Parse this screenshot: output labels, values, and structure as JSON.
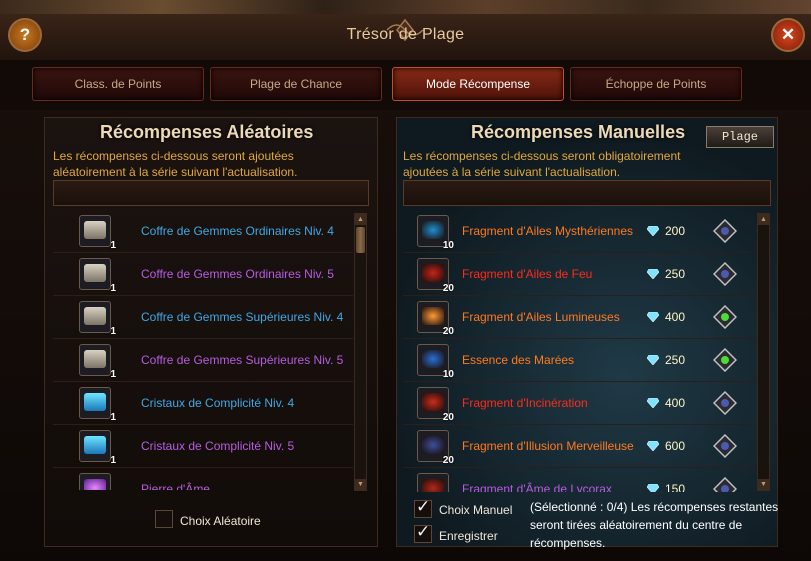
{
  "window": {
    "title": "Trésor de Plage",
    "help_label": "?",
    "close_label": "✕"
  },
  "tabs": [
    {
      "label": "Class. de Points",
      "active": false
    },
    {
      "label": "Plage de Chance",
      "active": false
    },
    {
      "label": "Mode Récompense",
      "active": true
    },
    {
      "label": "Échoppe de Points",
      "active": false
    }
  ],
  "random_panel": {
    "title": "Récompenses Aléatoires",
    "description_line1": "Les récompenses ci-dessous seront ajoutées",
    "description_line2": "aléatoirement à la série suivant l'actualisation.",
    "items": [
      {
        "name": "Coffre de Gemmes Ordinaires Niv. 4",
        "qty": "1",
        "color": "#3fa8e6",
        "icon": "chest-icon"
      },
      {
        "name": "Coffre de Gemmes Ordinaires Niv. 5",
        "qty": "1",
        "color": "#b75ce0",
        "icon": "chest-icon"
      },
      {
        "name": "Coffre de Gemmes Supérieures Niv. 4",
        "qty": "1",
        "color": "#3fa8e6",
        "icon": "chest-icon"
      },
      {
        "name": "Coffre de Gemmes Supérieures Niv. 5",
        "qty": "1",
        "color": "#b75ce0",
        "icon": "chest-icon"
      },
      {
        "name": "Cristaux de Complicité Niv. 4",
        "qty": "1",
        "color": "#3fa8e6",
        "icon": "crystal-icon"
      },
      {
        "name": "Cristaux de Complicité Niv. 5",
        "qty": "1",
        "color": "#b75ce0",
        "icon": "crystal-icon"
      },
      {
        "name": "Pierre d'Âme",
        "qty": "",
        "color": "#b75ce0",
        "icon": "soul-stone-icon"
      }
    ],
    "random_choice_label": "Choix Aléatoire",
    "random_choice_checked": false
  },
  "manual_panel": {
    "title": "Récompenses Manuelles",
    "plage_button": "Plage",
    "description_line1": "Les récompenses ci-dessous seront obligatoirement",
    "description_line2": "ajoutées à la série suivant l'actualisation.",
    "items": [
      {
        "name": "Fragment d'Ailes Mysthériennes",
        "qty": "10",
        "price": "200",
        "color": "#ff7a1f",
        "selected": false,
        "icon": "wings-fragment-icon"
      },
      {
        "name": "Fragment d'Ailes de Feu",
        "qty": "20",
        "price": "250",
        "color": "#ff2b1a",
        "selected": false,
        "icon": "fire-wings-icon"
      },
      {
        "name": "Fragment d'Ailes Lumineuses",
        "qty": "20",
        "price": "400",
        "color": "#ff7a1f",
        "selected": true,
        "icon": "light-wings-icon"
      },
      {
        "name": "Essence des Marées",
        "qty": "10",
        "price": "250",
        "color": "#ff7a1f",
        "selected": true,
        "icon": "tide-essence-icon"
      },
      {
        "name": "Fragment d'Incinération",
        "qty": "20",
        "price": "400",
        "color": "#ff2b1a",
        "selected": false,
        "icon": "incineration-icon"
      },
      {
        "name": "Fragment d'Illusion Merveilleuse",
        "qty": "20",
        "price": "600",
        "color": "#ff7a1f",
        "selected": false,
        "icon": "illusion-fragment-icon"
      },
      {
        "name": "Fragment d'Âme de Lycorax",
        "qty": "",
        "price": "150",
        "color": "#b75ce0",
        "selected": false,
        "icon": "lycorax-fragment-icon"
      }
    ],
    "manual_choice_label": "Choix Manuel",
    "manual_choice_checked": true,
    "save_label": "Enregistrer",
    "save_checked": true,
    "note_line1": "(Sélectionné : 0/4) Les récompenses restantes",
    "note_line2": "seront tirées aléatoirement du centre de",
    "note_line3": "récompenses."
  }
}
